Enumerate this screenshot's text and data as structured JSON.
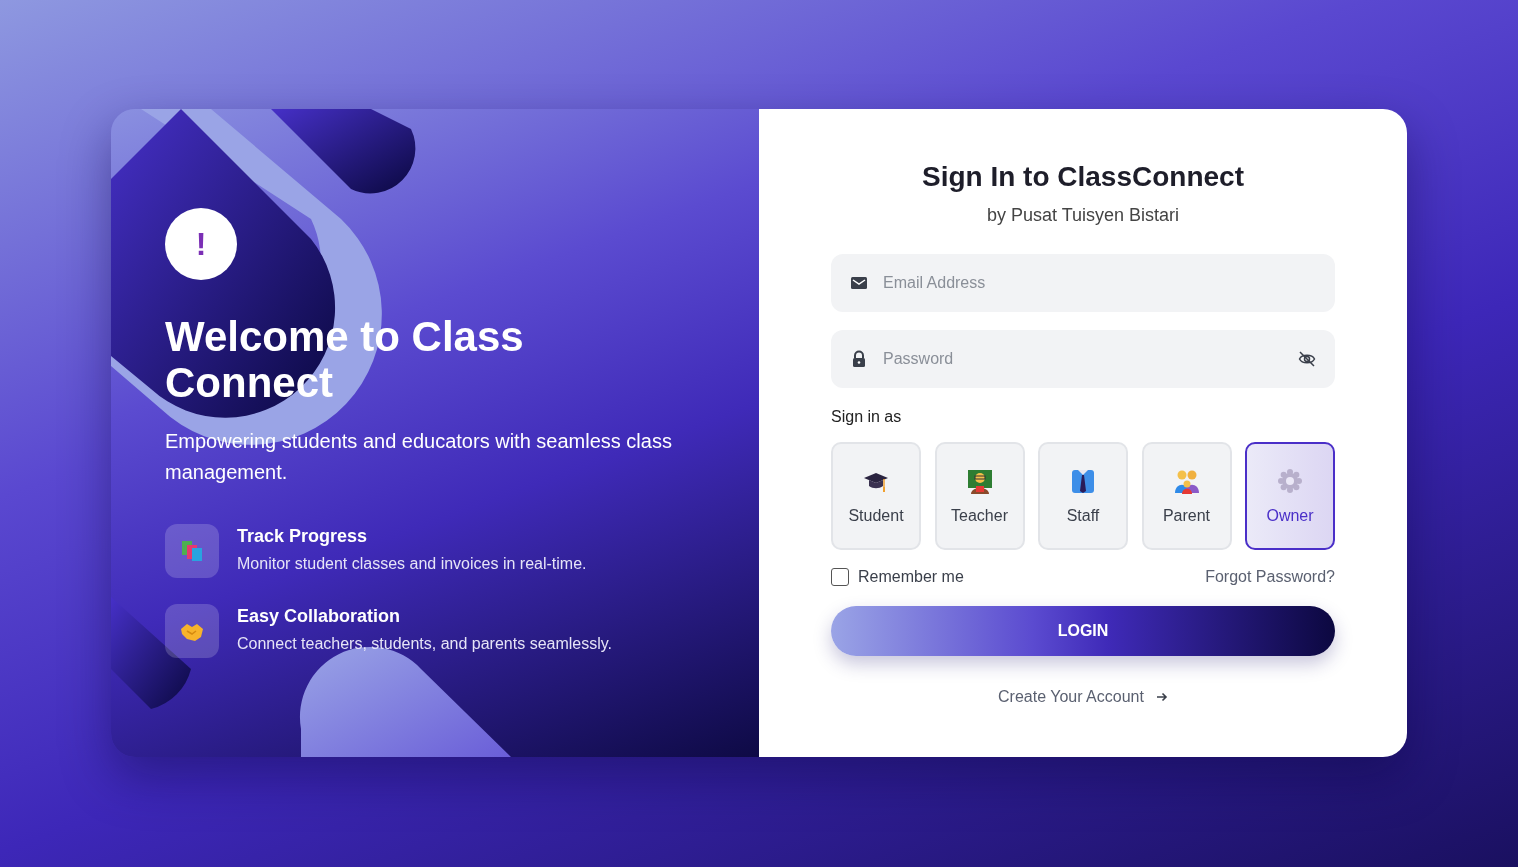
{
  "hero": {
    "logo_mark": "!",
    "title": "Welcome to Class Connect",
    "subtitle": "Empowering students and educators with seamless class management.",
    "features": [
      {
        "kind": "books",
        "title": "Track Progress",
        "description": "Monitor student classes and invoices in real-time."
      },
      {
        "kind": "handshake",
        "title": "Easy Collaboration",
        "description": "Connect teachers, students, and parents seamlessly."
      }
    ]
  },
  "form": {
    "title": "Sign In to ClassConnect",
    "subtitle": "by Pusat Tuisyen Bistari",
    "email": {
      "placeholder": "Email Address"
    },
    "password": {
      "placeholder": "Password"
    },
    "role_label": "Sign in as",
    "roles": [
      {
        "kind": "student",
        "label": "Student",
        "selected": false
      },
      {
        "kind": "teacher",
        "label": "Teacher",
        "selected": false
      },
      {
        "kind": "staff",
        "label": "Staff",
        "selected": false
      },
      {
        "kind": "parent",
        "label": "Parent",
        "selected": false
      },
      {
        "kind": "owner",
        "label": "Owner",
        "selected": true
      }
    ],
    "remember": {
      "label": "Remember me",
      "checked": false
    },
    "forgot_link": "Forgot Password?",
    "login_button": "LOGIN",
    "create_link": "Create Your Account"
  }
}
